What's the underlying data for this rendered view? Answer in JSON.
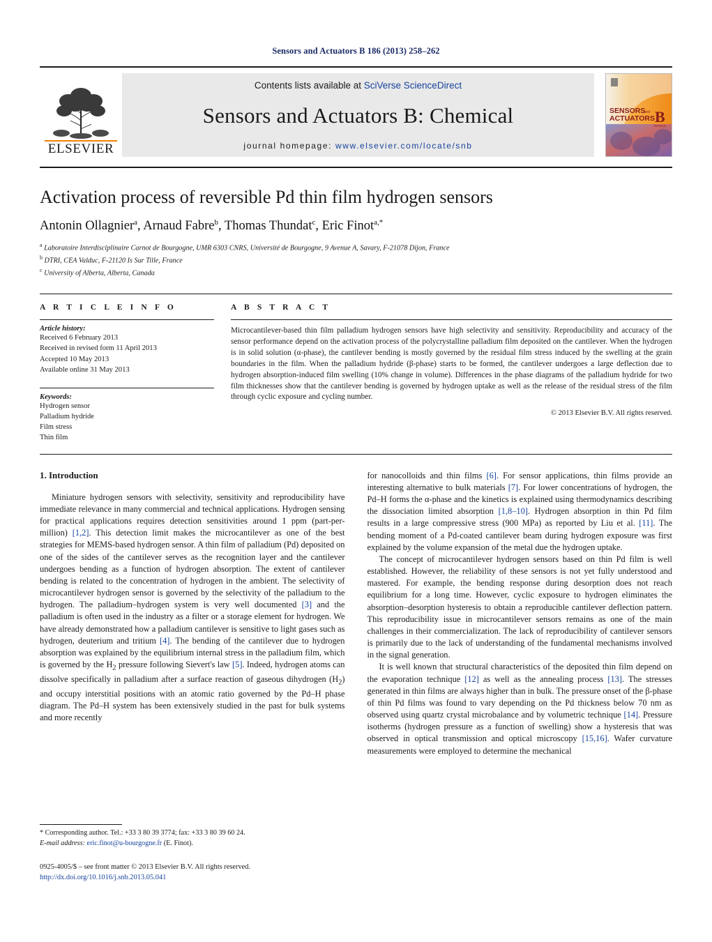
{
  "running_head": "Sensors and Actuators B 186 (2013) 258–262",
  "masthead": {
    "contents_prefix": "Contents lists available at ",
    "contents_link": "SciVerse ScienceDirect",
    "journal_title": "Sensors and Actuators B: Chemical",
    "homepage_label": "journal homepage: ",
    "homepage_url": "www.elsevier.com/locate/snb",
    "publisher": "ELSEVIER",
    "cover": {
      "line1": "SENSORS",
      "line1_small": "and",
      "line2": "ACTUATORS",
      "letter": "B",
      "sub": "Chemical"
    }
  },
  "article": {
    "title": "Activation process of reversible Pd thin film hydrogen sensors",
    "authors_html": "Antonin Ollagnier<sup>a</sup>, Arnaud Fabre<sup>b</sup>, Thomas Thundat<sup>c</sup>, Eric Finot<sup>a,*</sup>",
    "affiliations": [
      "Laboratoire Interdisciplinaire Carnot de Bourgogne, UMR 6303 CNRS, Université de Bourgogne, 9 Avenue A, Savary, F-21078 Dijon, France",
      "DTRI, CEA Valduc, F-21120 Is Sur Tille, France",
      "University of Alberta, Alberta, Canada"
    ],
    "affiliation_marks": [
      "a",
      "b",
      "c"
    ]
  },
  "article_info": {
    "heading": "A R T I C L E   I N F O",
    "history_label": "Article history:",
    "history": [
      "Received 6 February 2013",
      "Received in revised form 11 April 2013",
      "Accepted 10 May 2013",
      "Available online 31 May 2013"
    ],
    "keywords_label": "Keywords:",
    "keywords": [
      "Hydrogen sensor",
      "Palladium hydride",
      "Film stress",
      "Thin film"
    ]
  },
  "abstract": {
    "heading": "A B S T R A C T",
    "text": "Microcantilever-based thin film palladium hydrogen sensors have high selectivity and sensitivity. Reproducibility and accuracy of the sensor performance depend on the activation process of the polycrystalline palladium film deposited on the cantilever. When the hydrogen is in solid solution (α-phase), the cantilever bending is mostly governed by the residual film stress induced by the swelling at the grain boundaries in the film. When the palladium hydride (β-phase) starts to be formed, the cantilever undergoes a large deflection due to hydrogen absorption-induced film swelling (10% change in volume). Differences in the phase diagrams of the palladium hydride for two film thicknesses show that the cantilever bending is governed by hydrogen uptake as well as the release of the residual stress of the film through cyclic exposure and cycling number.",
    "copyright": "© 2013 Elsevier B.V. All rights reserved."
  },
  "body": {
    "section_heading": "1.  Introduction",
    "left_paragraphs": [
      "Miniature hydrogen sensors with selectivity, sensitivity and reproducibility have immediate relevance in many commercial and technical applications. Hydrogen sensing for practical applications requires detection sensitivities around 1 ppm (part-per-million) [1,2]. This detection limit makes the microcantilever as one of the best strategies for MEMS-based hydrogen sensor. A thin film of palladium (Pd) deposited on one of the sides of the cantilever serves as the recognition layer and the cantilever undergoes bending as a function of hydrogen absorption. The extent of cantilever bending is related to the concentration of hydrogen in the ambient. The selectivity of microcantilever hydrogen sensor is governed by the selectivity of the palladium to the hydrogen. The palladium–hydrogen system is very well documented [3] and the palladium is often used in the industry as a filter or a storage element for hydrogen. We have already demonstrated how a palladium cantilever is sensitive to light gases such as hydrogen, deuterium and tritium [4]. The bending of the cantilever due to hydrogen absorption was explained by the equilibrium internal stress in the palladium film, which is governed by the H2 pressure following Sievert's law [5]. Indeed, hydrogen atoms can dissolve specifically in palladium after a surface reaction of gaseous dihydrogen (H2) and occupy interstitial positions with an atomic ratio governed by the Pd–H phase diagram. The Pd–H system has been extensively studied in the past for bulk systems and more recently"
    ],
    "right_paragraphs": [
      "for nanocolloids and thin films [6]. For sensor applications, thin films provide an interesting alternative to bulk materials [7]. For lower concentrations of hydrogen, the Pd–H forms the α-phase and the kinetics is explained using thermodynamics describing the dissociation limited absorption [1,8–10]. Hydrogen absorption in thin Pd film results in a large compressive stress (900 MPa) as reported by Liu et al. [11]. The bending moment of a Pd-coated cantilever beam during hydrogen exposure was first explained by the volume expansion of the metal due the hydrogen uptake.",
      "The concept of microcantilever hydrogen sensors based on thin Pd film is well established. However, the reliability of these sensors is not yet fully understood and mastered. For example, the bending response during desorption does not reach equilibrium for a long time. However, cyclic exposure to hydrogen eliminates the absorption–desorption hysteresis to obtain a reproducible cantilever deflection pattern. This reproducibility issue in microcantilever sensors remains as one of the main challenges in their commercialization. The lack of reproducibility of cantilever sensors is primarily due to the lack of understanding of the fundamental mechanisms involved in the signal generation.",
      "It is well known that structural characteristics of the deposited thin film depend on the evaporation technique [12] as well as the annealing process [13]. The stresses generated in thin films are always higher than in bulk. The pressure onset of the β-phase of thin Pd films was found to vary depending on the Pd thickness below 70 nm as observed using quartz crystal microbalance and by volumetric technique [14]. Pressure isotherms (hydrogen pressure as a function of swelling) show a hysteresis that was observed in optical transmission and optical microscopy [15,16]. Wafer curvature measurements were employed to determine the mechanical"
    ]
  },
  "footnotes": {
    "corresponding": "* Corresponding author. Tel.: +33 3 80 39 3774; fax: +33 3 80 39 60 24.",
    "email_label": "E-mail address: ",
    "email": "eric.finot@u-bourgogne.fr",
    "email_suffix": " (E. Finot).",
    "issn": "0925-4005/$ – see front matter © 2013 Elsevier B.V. All rights reserved.",
    "doi": "http://dx.doi.org/10.1016/j.snb.2013.05.041"
  },
  "colors": {
    "link_blue": "#16429b",
    "running_head_blue": "#1a2a66",
    "elsevier_orange": "#F08000",
    "masthead_grey": "#e9e9e9"
  }
}
